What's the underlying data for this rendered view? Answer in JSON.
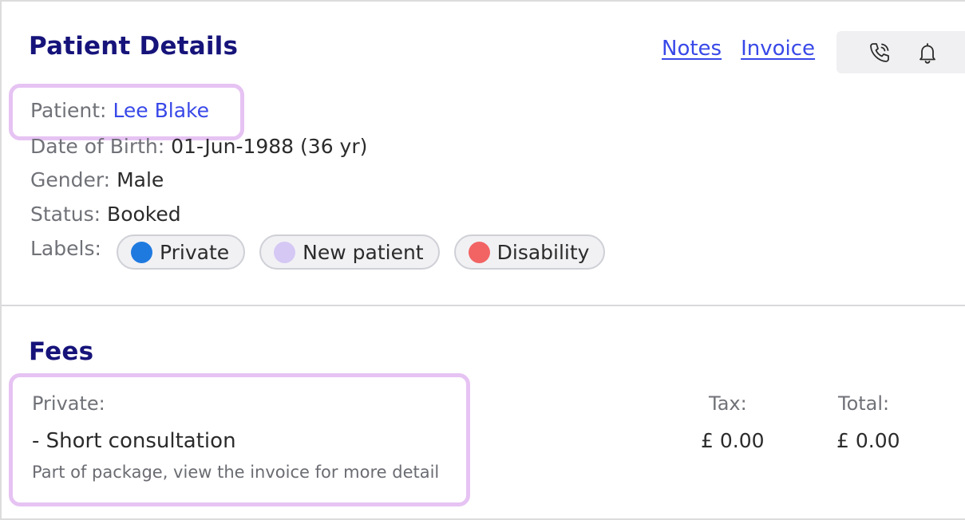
{
  "details": {
    "title": "Patient Details",
    "nav": {
      "notes": "Notes",
      "invoice": "Invoice"
    },
    "icons": [
      "phone-call-icon",
      "bell-icon"
    ],
    "patient": {
      "label": "Patient:",
      "value": "Lee Blake"
    },
    "dob": {
      "label": "Date of Birth:",
      "value": "01-Jun-1988 (36 yr)"
    },
    "gender": {
      "label": "Gender:",
      "value": "Male"
    },
    "status": {
      "label": "Status:",
      "value": "Booked"
    },
    "labels": {
      "label": "Labels:",
      "items": [
        {
          "text": "Private",
          "color": "#1f7ae0"
        },
        {
          "text": "New patient",
          "color": "#d5c8f4"
        },
        {
          "text": "Disability",
          "color": "#f26464"
        }
      ]
    }
  },
  "fees": {
    "title": "Fees",
    "category": "Private:",
    "item": "- Short consultation",
    "note": "Part of package, view the invoice for more detail",
    "tax_label": "Tax:",
    "total_label": "Total:",
    "tax_value": "£ 0.00",
    "total_value": "£ 0.00"
  },
  "colors": {
    "title": "#16147a",
    "link": "#3848e8",
    "highlight": "#e6c3f3"
  }
}
